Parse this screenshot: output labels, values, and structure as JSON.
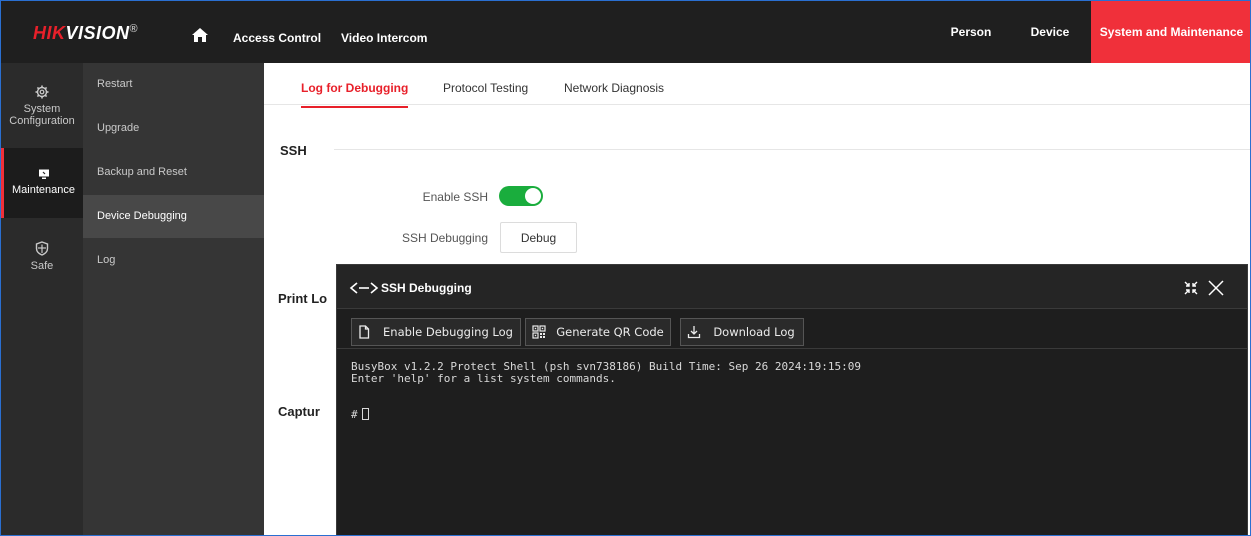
{
  "brand": {
    "name_red": "HIK",
    "name_white": "VISION",
    "reg": "®"
  },
  "topnav": {
    "left": [
      "Access Control",
      "Video Intercom"
    ],
    "right": [
      "Person",
      "Device",
      "System and Maintenance"
    ],
    "active": "System and Maintenance"
  },
  "sidebar": {
    "items": [
      {
        "label": "System Configuration",
        "icon": "gear-icon"
      },
      {
        "label": "Maintenance",
        "icon": "monitor-icon",
        "active": true
      },
      {
        "label": "Safe",
        "icon": "shield-icon"
      }
    ]
  },
  "submenu": {
    "items": [
      "Restart",
      "Upgrade",
      "Backup and Reset",
      "Device Debugging",
      "Log"
    ],
    "active": "Device Debugging"
  },
  "tabs": {
    "items": [
      "Log for Debugging",
      "Protocol Testing",
      "Network Diagnosis"
    ],
    "active": "Log for Debugging"
  },
  "ssh": {
    "section_title": "SSH",
    "enable_label": "Enable SSH",
    "enabled": true,
    "debugging_label": "SSH Debugging",
    "debug_button": "Debug"
  },
  "sections": {
    "print_log_partial": "Print Lo",
    "capture_partial": "Captur"
  },
  "dialog": {
    "title": "SSH Debugging",
    "toolbar": [
      "Enable Debugging Log",
      "Generate QR Code",
      "Download Log"
    ],
    "terminal_lines": [
      "BusyBox v1.2.2 Protect Shell (psh svn738186) Build Time: Sep 26 2024:19:15:09",
      "Enter 'help' for a list system commands."
    ],
    "prompt": "#"
  },
  "colors": {
    "accent": "#e8202a",
    "topbar": "#1f1f1f",
    "toggle_on": "#1aad3d",
    "terminal_bg": "#1e1e1e"
  }
}
